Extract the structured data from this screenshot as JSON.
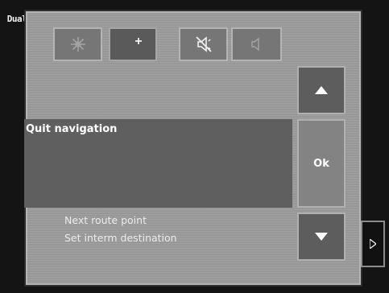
{
  "brand": {
    "label": "Dual"
  },
  "toolbar": {
    "day_mode": {
      "icon": "sun-icon"
    },
    "night_mode": {
      "icon": "moon-star-icon"
    },
    "mute": {
      "icon": "speaker-muted-icon"
    },
    "sound": {
      "icon": "speaker-icon"
    }
  },
  "menu": {
    "selected_item": "Quit navigation",
    "items": [
      {
        "label": "Next route point"
      },
      {
        "label": "Set interm destination"
      }
    ]
  },
  "controls": {
    "ok_label": "Ok",
    "scroll_up_icon": "triangle-up-icon",
    "scroll_down_icon": "triangle-down-icon",
    "side_arrow_icon": "triangle-right-icon"
  },
  "colors": {
    "panel": "#9b9b9b",
    "selected_row": "#5f5f5f",
    "button_dark": "#5d5d5d",
    "ok_button": "#838383",
    "background": "#141414"
  }
}
